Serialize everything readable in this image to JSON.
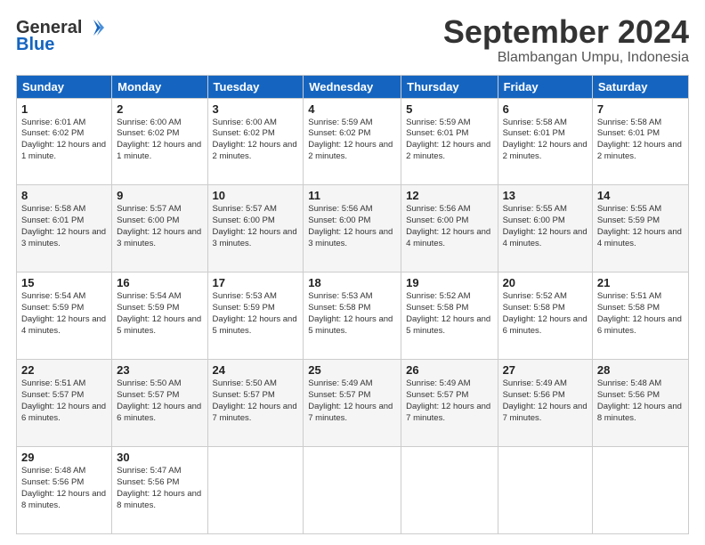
{
  "logo": {
    "line1": "General",
    "line2": "Blue"
  },
  "title": "September 2024",
  "location": "Blambangan Umpu, Indonesia",
  "headers": [
    "Sunday",
    "Monday",
    "Tuesday",
    "Wednesday",
    "Thursday",
    "Friday",
    "Saturday"
  ],
  "weeks": [
    [
      {
        "day": "1",
        "sunrise": "6:01 AM",
        "sunset": "6:02 PM",
        "daylight": "12 hours and 1 minute."
      },
      {
        "day": "2",
        "sunrise": "6:00 AM",
        "sunset": "6:02 PM",
        "daylight": "12 hours and 1 minute."
      },
      {
        "day": "3",
        "sunrise": "6:00 AM",
        "sunset": "6:02 PM",
        "daylight": "12 hours and 2 minutes."
      },
      {
        "day": "4",
        "sunrise": "5:59 AM",
        "sunset": "6:02 PM",
        "daylight": "12 hours and 2 minutes."
      },
      {
        "day": "5",
        "sunrise": "5:59 AM",
        "sunset": "6:01 PM",
        "daylight": "12 hours and 2 minutes."
      },
      {
        "day": "6",
        "sunrise": "5:58 AM",
        "sunset": "6:01 PM",
        "daylight": "12 hours and 2 minutes."
      },
      {
        "day": "7",
        "sunrise": "5:58 AM",
        "sunset": "6:01 PM",
        "daylight": "12 hours and 2 minutes."
      }
    ],
    [
      {
        "day": "8",
        "sunrise": "5:58 AM",
        "sunset": "6:01 PM",
        "daylight": "12 hours and 3 minutes."
      },
      {
        "day": "9",
        "sunrise": "5:57 AM",
        "sunset": "6:00 PM",
        "daylight": "12 hours and 3 minutes."
      },
      {
        "day": "10",
        "sunrise": "5:57 AM",
        "sunset": "6:00 PM",
        "daylight": "12 hours and 3 minutes."
      },
      {
        "day": "11",
        "sunrise": "5:56 AM",
        "sunset": "6:00 PM",
        "daylight": "12 hours and 3 minutes."
      },
      {
        "day": "12",
        "sunrise": "5:56 AM",
        "sunset": "6:00 PM",
        "daylight": "12 hours and 4 minutes."
      },
      {
        "day": "13",
        "sunrise": "5:55 AM",
        "sunset": "6:00 PM",
        "daylight": "12 hours and 4 minutes."
      },
      {
        "day": "14",
        "sunrise": "5:55 AM",
        "sunset": "5:59 PM",
        "daylight": "12 hours and 4 minutes."
      }
    ],
    [
      {
        "day": "15",
        "sunrise": "5:54 AM",
        "sunset": "5:59 PM",
        "daylight": "12 hours and 4 minutes."
      },
      {
        "day": "16",
        "sunrise": "5:54 AM",
        "sunset": "5:59 PM",
        "daylight": "12 hours and 5 minutes."
      },
      {
        "day": "17",
        "sunrise": "5:53 AM",
        "sunset": "5:59 PM",
        "daylight": "12 hours and 5 minutes."
      },
      {
        "day": "18",
        "sunrise": "5:53 AM",
        "sunset": "5:58 PM",
        "daylight": "12 hours and 5 minutes."
      },
      {
        "day": "19",
        "sunrise": "5:52 AM",
        "sunset": "5:58 PM",
        "daylight": "12 hours and 5 minutes."
      },
      {
        "day": "20",
        "sunrise": "5:52 AM",
        "sunset": "5:58 PM",
        "daylight": "12 hours and 6 minutes."
      },
      {
        "day": "21",
        "sunrise": "5:51 AM",
        "sunset": "5:58 PM",
        "daylight": "12 hours and 6 minutes."
      }
    ],
    [
      {
        "day": "22",
        "sunrise": "5:51 AM",
        "sunset": "5:57 PM",
        "daylight": "12 hours and 6 minutes."
      },
      {
        "day": "23",
        "sunrise": "5:50 AM",
        "sunset": "5:57 PM",
        "daylight": "12 hours and 6 minutes."
      },
      {
        "day": "24",
        "sunrise": "5:50 AM",
        "sunset": "5:57 PM",
        "daylight": "12 hours and 7 minutes."
      },
      {
        "day": "25",
        "sunrise": "5:49 AM",
        "sunset": "5:57 PM",
        "daylight": "12 hours and 7 minutes."
      },
      {
        "day": "26",
        "sunrise": "5:49 AM",
        "sunset": "5:57 PM",
        "daylight": "12 hours and 7 minutes."
      },
      {
        "day": "27",
        "sunrise": "5:49 AM",
        "sunset": "5:56 PM",
        "daylight": "12 hours and 7 minutes."
      },
      {
        "day": "28",
        "sunrise": "5:48 AM",
        "sunset": "5:56 PM",
        "daylight": "12 hours and 8 minutes."
      }
    ],
    [
      {
        "day": "29",
        "sunrise": "5:48 AM",
        "sunset": "5:56 PM",
        "daylight": "12 hours and 8 minutes."
      },
      {
        "day": "30",
        "sunrise": "5:47 AM",
        "sunset": "5:56 PM",
        "daylight": "12 hours and 8 minutes."
      },
      null,
      null,
      null,
      null,
      null
    ]
  ]
}
